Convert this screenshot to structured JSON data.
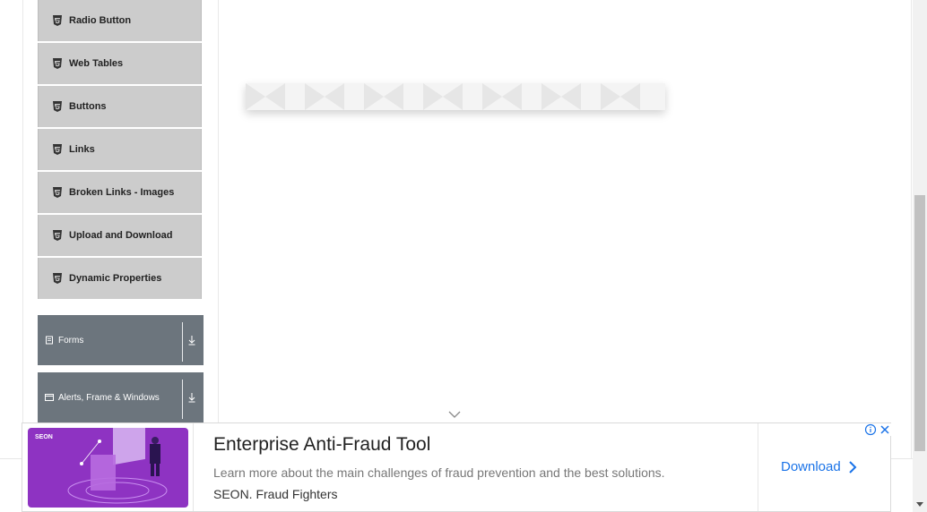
{
  "sidebar": {
    "items": [
      {
        "label": "Radio Button",
        "icon": "html5-icon"
      },
      {
        "label": "Web Tables",
        "icon": "html5-icon"
      },
      {
        "label": "Buttons",
        "icon": "html5-icon"
      },
      {
        "label": "Links",
        "icon": "html5-icon"
      },
      {
        "label": "Broken Links - Images",
        "icon": "html5-icon"
      },
      {
        "label": "Upload and Download",
        "icon": "html5-icon"
      },
      {
        "label": "Dynamic Properties",
        "icon": "html5-icon"
      }
    ],
    "groups": [
      {
        "label": "Forms",
        "icon": "form-icon",
        "action_icon": "download-arrow-icon"
      },
      {
        "label": "Alerts, Frame & Windows",
        "icon": "window-icon",
        "action_icon": "download-arrow-icon"
      }
    ]
  },
  "ad": {
    "brand": "SEON",
    "title": "Enterprise Anti-Fraud Tool",
    "description": "Learn more about the main challenges of fraud prevention and the best solutions.",
    "source": "SEON. Fraud Fighters",
    "cta_label": "Download",
    "colors": {
      "image_bg": "#8e33c2",
      "cta": "#1a73e8"
    }
  },
  "colors": {
    "menu_item_bg": "#cccccc",
    "group_bg": "#6c757d"
  }
}
